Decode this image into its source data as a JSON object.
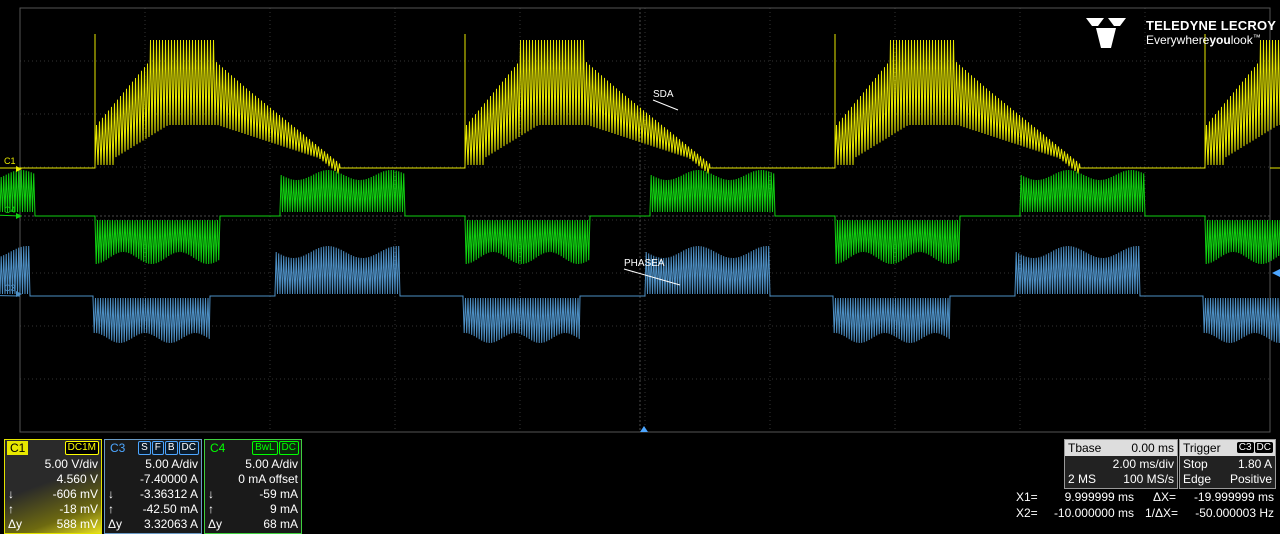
{
  "brand": {
    "name": "TELEDYNE LECROY",
    "tagline_pre": "Everywhere",
    "tagline_bold": "you",
    "tagline_post": "look",
    "tm": "™"
  },
  "channels_on_screen": {
    "c1_marker": "C1",
    "c4_marker": "C4",
    "c3_marker": "C3",
    "sda_label": "SDA",
    "phasea_label": "PHASEA"
  },
  "colors": {
    "c1": "#e8e800",
    "c3": "#4d8fc4",
    "c4": "#10d010",
    "grid": "#3a3a3a"
  },
  "c1": {
    "name": "C1",
    "tags": [
      "DC1M"
    ],
    "vdiv": "5.00 V/div",
    "offset": "4.560 V",
    "rows": [
      {
        "sym": "↓",
        "val": "-606 mV"
      },
      {
        "sym": "↑",
        "val": "-18 mV"
      },
      {
        "sym": "Δy",
        "val": "588 mV"
      }
    ]
  },
  "c3": {
    "name": "C3",
    "tags": [
      "S",
      "F",
      "B",
      "DC"
    ],
    "vdiv": "5.00 A/div",
    "offset": "-7.40000 A",
    "rows": [
      {
        "sym": "↓",
        "val": "-3.36312 A"
      },
      {
        "sym": "↑",
        "val": "-42.50 mA"
      },
      {
        "sym": "Δy",
        "val": "3.32063 A"
      }
    ]
  },
  "c4": {
    "name": "C4",
    "tags": [
      "BwL",
      "DC"
    ],
    "vdiv": "5.00 A/div",
    "offset": "0 mA offset",
    "rows": [
      {
        "sym": "↓",
        "val": "-59 mA"
      },
      {
        "sym": "↑",
        "val": "9 mA"
      },
      {
        "sym": "Δy",
        "val": "68 mA"
      }
    ]
  },
  "timebase": {
    "title": "Tbase",
    "delay": "0.00 ms",
    "tdiv": "2.00 ms/div",
    "points": "2 MS",
    "rate": "100 MS/s"
  },
  "trigger": {
    "title": "Trigger",
    "tags": [
      "C3",
      "DC"
    ],
    "mode": "Stop",
    "level": "1.80 A",
    "type": "Edge",
    "slope": "Positive"
  },
  "cursors": {
    "x1_label": "X1=",
    "x1": "9.999999 ms",
    "dx_label": "ΔX=",
    "dx": "-19.999999 ms",
    "x2_label": "X2=",
    "x2": "-10.000000 ms",
    "idx_label": "1/ΔX=",
    "idx": "-50.000003 Hz"
  }
}
